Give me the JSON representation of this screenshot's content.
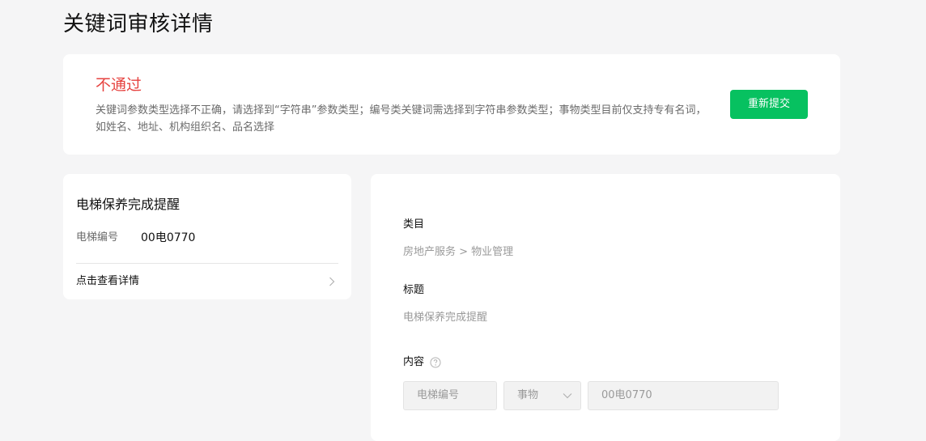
{
  "page": {
    "title": "关键词审核详情"
  },
  "review": {
    "status": "不通过",
    "reason": "关键词参数类型选择不正确，请选择到“字符串”参数类型；编号类关键词需选择到字符串参数类型；事物类型目前仅支持专有名词，如姓名、地址、机构组织名、品名选择",
    "resubmit_label": "重新提交"
  },
  "preview": {
    "title": "电梯保养完成提醒",
    "field_label": "电梯编号",
    "field_value": "00电0770",
    "details_link": "点击查看详情"
  },
  "detail": {
    "category_label": "类目",
    "category_value": "房地产服务 > 物业管理",
    "title_label": "标题",
    "title_value": "电梯保养完成提醒",
    "content_label": "内容",
    "keyword_name": "电梯编号",
    "keyword_type": "事物",
    "keyword_example": "00电0770"
  },
  "colors": {
    "accent": "#07c160",
    "error": "#e64340"
  },
  "icons": {
    "view_details": "chevron-right-icon",
    "content_help": "help-icon",
    "type_select": "chevron-down-icon"
  }
}
